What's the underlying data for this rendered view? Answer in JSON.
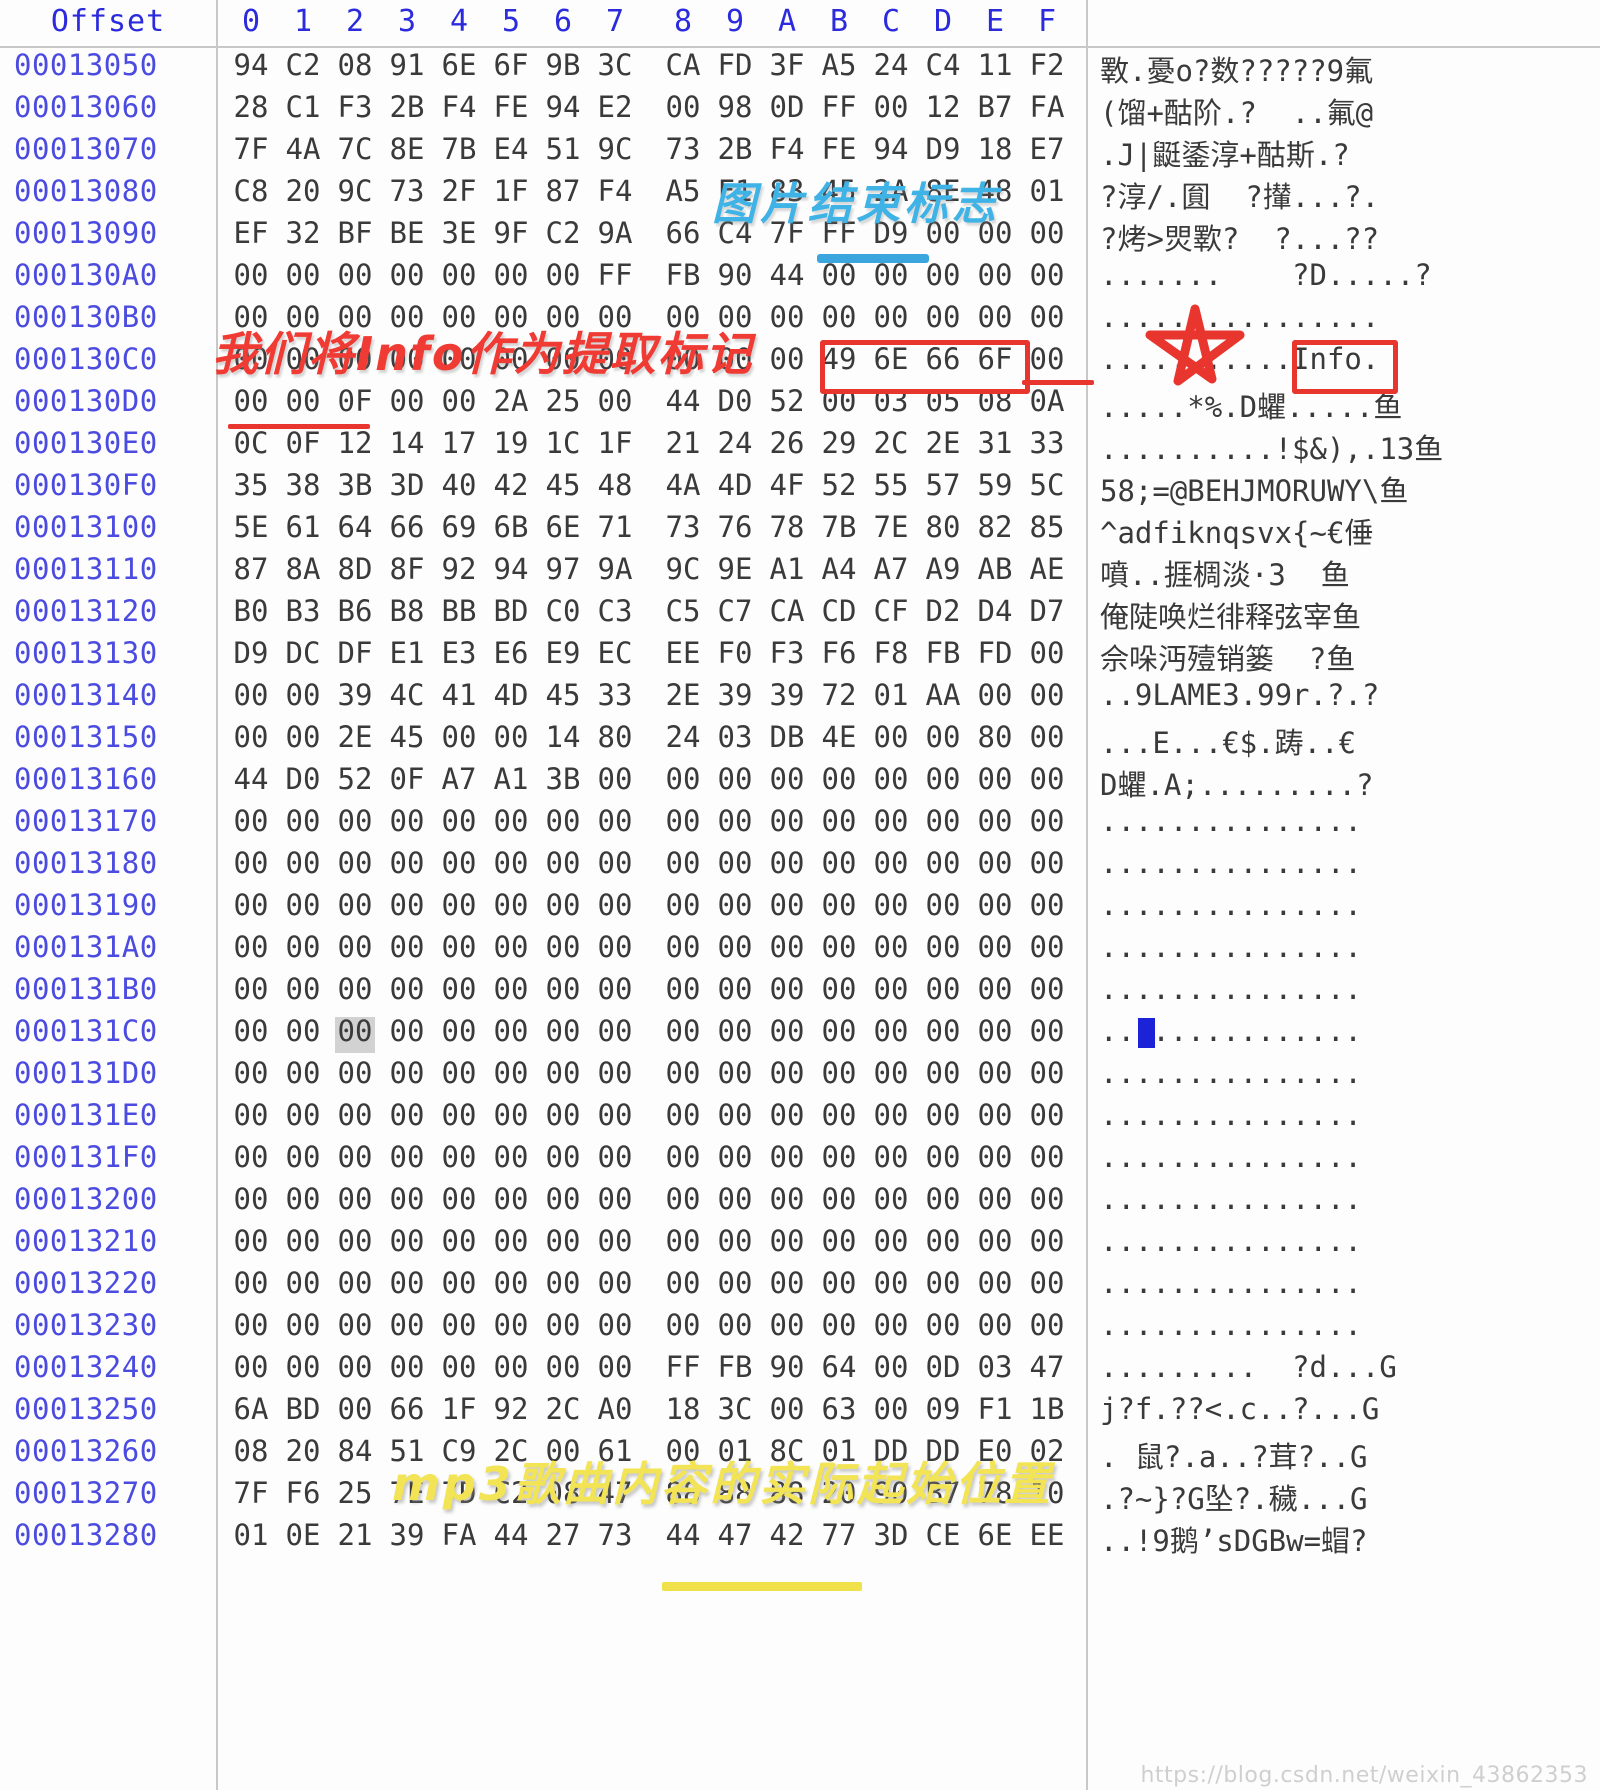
{
  "app": {
    "type": "hex-editor",
    "pane_labels": {
      "offset": "Offset"
    },
    "column_headers": [
      "0",
      "1",
      "2",
      "3",
      "4",
      "5",
      "6",
      "7",
      "8",
      "9",
      "A",
      "B",
      "C",
      "D",
      "E",
      "F"
    ]
  },
  "colors": {
    "offset_text": "#4b4be0",
    "header_text": "#2b2bdd",
    "hex_text": "#3a3a3a",
    "annotation_red": "#ef3b33",
    "annotation_blue": "#3fb3e6",
    "annotation_yellow": "#f2e455",
    "selection_blue": "#1b22d8",
    "selection_grey": "#d2d2d2",
    "grid_line": "#c8c8c8"
  },
  "rows": [
    {
      "offset": "00013050",
      "bytes": [
        "94",
        "C2",
        "08",
        "91",
        "6E",
        "6F",
        "9B",
        "3C",
        "CA",
        "FD",
        "3F",
        "A5",
        "24",
        "C4",
        "11",
        "F2"
      ],
      "ascii": "斁.憂o?数?????9氟"
    },
    {
      "offset": "00013060",
      "bytes": [
        "28",
        "C1",
        "F3",
        "2B",
        "F4",
        "FE",
        "94",
        "E2",
        "00",
        "98",
        "0D",
        "FF",
        "00",
        "12",
        "B7",
        "FA"
      ],
      "ascii": "(馏+酤阶.?  ..氟@"
    },
    {
      "offset": "00013070",
      "bytes": [
        "7F",
        "4A",
        "7C",
        "8E",
        "7B",
        "E4",
        "51",
        "9C",
        "73",
        "2B",
        "F4",
        "FE",
        "94",
        "D9",
        "18",
        "E7"
      ],
      "ascii": ".J|鼮鋈淳+酤斯.?"
    },
    {
      "offset": "00013080",
      "bytes": [
        "C8",
        "20",
        "9C",
        "73",
        "2F",
        "1F",
        "87",
        "F4",
        "A5",
        "F1",
        "83",
        "45",
        "2A",
        "8E",
        "48",
        "01"
      ],
      "ascii": "?淳/.圎  ?攆...?."
    },
    {
      "offset": "00013090",
      "bytes": [
        "EF",
        "32",
        "BF",
        "BE",
        "3E",
        "9F",
        "C2",
        "9A",
        "66",
        "C4",
        "7F",
        "FF",
        "D9",
        "00",
        "00",
        "00"
      ],
      "ascii": "?烤>焸歝?  ?...??"
    },
    {
      "offset": "000130A0",
      "bytes": [
        "00",
        "00",
        "00",
        "00",
        "00",
        "00",
        "00",
        "FF",
        "FB",
        "90",
        "44",
        "00",
        "00",
        "00",
        "00",
        "00"
      ],
      "ascii": ".......    ?D.....?"
    },
    {
      "offset": "000130B0",
      "bytes": [
        "00",
        "00",
        "00",
        "00",
        "00",
        "00",
        "00",
        "00",
        "00",
        "00",
        "00",
        "00",
        "00",
        "00",
        "00",
        "00"
      ],
      "ascii": "................"
    },
    {
      "offset": "000130C0",
      "bytes": [
        "00",
        "00",
        "00",
        "00",
        "00",
        "00",
        "00",
        "00",
        "00",
        "00",
        "00",
        "49",
        "6E",
        "66",
        "6F",
        "00"
      ],
      "ascii": "...........Info."
    },
    {
      "offset": "000130D0",
      "bytes": [
        "00",
        "00",
        "0F",
        "00",
        "00",
        "2A",
        "25",
        "00",
        "44",
        "D0",
        "52",
        "00",
        "03",
        "05",
        "08",
        "0A"
      ],
      "ascii": ".....*%.D蠷.....鱼"
    },
    {
      "offset": "000130E0",
      "bytes": [
        "0C",
        "0F",
        "12",
        "14",
        "17",
        "19",
        "1C",
        "1F",
        "21",
        "24",
        "26",
        "29",
        "2C",
        "2E",
        "31",
        "33"
      ],
      "ascii": "..........!$&),.13鱼"
    },
    {
      "offset": "000130F0",
      "bytes": [
        "35",
        "38",
        "3B",
        "3D",
        "40",
        "42",
        "45",
        "48",
        "4A",
        "4D",
        "4F",
        "52",
        "55",
        "57",
        "59",
        "5C"
      ],
      "ascii": "58;=@BEHJMORUWY\\鱼"
    },
    {
      "offset": "00013100",
      "bytes": [
        "5E",
        "61",
        "64",
        "66",
        "69",
        "6B",
        "6E",
        "71",
        "73",
        "76",
        "78",
        "7B",
        "7E",
        "80",
        "82",
        "85"
      ],
      "ascii": "^adfiknqsvx{~€倕"
    },
    {
      "offset": "00013110",
      "bytes": [
        "87",
        "8A",
        "8D",
        "8F",
        "92",
        "94",
        "97",
        "9A",
        "9C",
        "9E",
        "A1",
        "A4",
        "A7",
        "A9",
        "AB",
        "AE"
      ],
      "ascii": "噴..捱椆淡·3  鱼"
    },
    {
      "offset": "00013120",
      "bytes": [
        "B0",
        "B3",
        "B6",
        "B8",
        "BB",
        "BD",
        "C0",
        "C3",
        "C5",
        "C7",
        "CA",
        "CD",
        "CF",
        "D2",
        "D4",
        "D7"
      ],
      "ascii": "俺陡唤烂徘释弦宰鱼"
    },
    {
      "offset": "00013130",
      "bytes": [
        "D9",
        "DC",
        "DF",
        "E1",
        "E3",
        "E6",
        "E9",
        "EC",
        "EE",
        "F0",
        "F3",
        "F6",
        "F8",
        "FB",
        "FD",
        "00"
      ],
      "ascii": "佘哚沔殪销篓  ?鱼"
    },
    {
      "offset": "00013140",
      "bytes": [
        "00",
        "00",
        "39",
        "4C",
        "41",
        "4D",
        "45",
        "33",
        "2E",
        "39",
        "39",
        "72",
        "01",
        "AA",
        "00",
        "00"
      ],
      "ascii": "..9LAME3.99r.?.?"
    },
    {
      "offset": "00013150",
      "bytes": [
        "00",
        "00",
        "2E",
        "45",
        "00",
        "00",
        "14",
        "80",
        "24",
        "03",
        "DB",
        "4E",
        "00",
        "00",
        "80",
        "00"
      ],
      "ascii": "...E...€$.踌..€"
    },
    {
      "offset": "00013160",
      "bytes": [
        "44",
        "D0",
        "52",
        "0F",
        "A7",
        "A1",
        "3B",
        "00",
        "00",
        "00",
        "00",
        "00",
        "00",
        "00",
        "00",
        "00"
      ],
      "ascii": "D蠷.A;.........?"
    },
    {
      "offset": "00013170",
      "bytes": [
        "00",
        "00",
        "00",
        "00",
        "00",
        "00",
        "00",
        "00",
        "00",
        "00",
        "00",
        "00",
        "00",
        "00",
        "00",
        "00"
      ],
      "ascii": "..............."
    },
    {
      "offset": "00013180",
      "bytes": [
        "00",
        "00",
        "00",
        "00",
        "00",
        "00",
        "00",
        "00",
        "00",
        "00",
        "00",
        "00",
        "00",
        "00",
        "00",
        "00"
      ],
      "ascii": "..............."
    },
    {
      "offset": "00013190",
      "bytes": [
        "00",
        "00",
        "00",
        "00",
        "00",
        "00",
        "00",
        "00",
        "00",
        "00",
        "00",
        "00",
        "00",
        "00",
        "00",
        "00"
      ],
      "ascii": "..............."
    },
    {
      "offset": "000131A0",
      "bytes": [
        "00",
        "00",
        "00",
        "00",
        "00",
        "00",
        "00",
        "00",
        "00",
        "00",
        "00",
        "00",
        "00",
        "00",
        "00",
        "00"
      ],
      "ascii": "..............."
    },
    {
      "offset": "000131B0",
      "bytes": [
        "00",
        "00",
        "00",
        "00",
        "00",
        "00",
        "00",
        "00",
        "00",
        "00",
        "00",
        "00",
        "00",
        "00",
        "00",
        "00"
      ],
      "ascii": "..............."
    },
    {
      "offset": "000131C0",
      "bytes": [
        "00",
        "00",
        "00",
        "00",
        "00",
        "00",
        "00",
        "00",
        "00",
        "00",
        "00",
        "00",
        "00",
        "00",
        "00",
        "00"
      ],
      "ascii": "..............."
    },
    {
      "offset": "000131D0",
      "bytes": [
        "00",
        "00",
        "00",
        "00",
        "00",
        "00",
        "00",
        "00",
        "00",
        "00",
        "00",
        "00",
        "00",
        "00",
        "00",
        "00"
      ],
      "ascii": "..............."
    },
    {
      "offset": "000131E0",
      "bytes": [
        "00",
        "00",
        "00",
        "00",
        "00",
        "00",
        "00",
        "00",
        "00",
        "00",
        "00",
        "00",
        "00",
        "00",
        "00",
        "00"
      ],
      "ascii": "..............."
    },
    {
      "offset": "000131F0",
      "bytes": [
        "00",
        "00",
        "00",
        "00",
        "00",
        "00",
        "00",
        "00",
        "00",
        "00",
        "00",
        "00",
        "00",
        "00",
        "00",
        "00"
      ],
      "ascii": "..............."
    },
    {
      "offset": "00013200",
      "bytes": [
        "00",
        "00",
        "00",
        "00",
        "00",
        "00",
        "00",
        "00",
        "00",
        "00",
        "00",
        "00",
        "00",
        "00",
        "00",
        "00"
      ],
      "ascii": "..............."
    },
    {
      "offset": "00013210",
      "bytes": [
        "00",
        "00",
        "00",
        "00",
        "00",
        "00",
        "00",
        "00",
        "00",
        "00",
        "00",
        "00",
        "00",
        "00",
        "00",
        "00"
      ],
      "ascii": "..............."
    },
    {
      "offset": "00013220",
      "bytes": [
        "00",
        "00",
        "00",
        "00",
        "00",
        "00",
        "00",
        "00",
        "00",
        "00",
        "00",
        "00",
        "00",
        "00",
        "00",
        "00"
      ],
      "ascii": "..............."
    },
    {
      "offset": "00013230",
      "bytes": [
        "00",
        "00",
        "00",
        "00",
        "00",
        "00",
        "00",
        "00",
        "00",
        "00",
        "00",
        "00",
        "00",
        "00",
        "00",
        "00"
      ],
      "ascii": "..............."
    },
    {
      "offset": "00013240",
      "bytes": [
        "00",
        "00",
        "00",
        "00",
        "00",
        "00",
        "00",
        "00",
        "FF",
        "FB",
        "90",
        "64",
        "00",
        "0D",
        "03",
        "47"
      ],
      "ascii": ".........  ?d...G"
    },
    {
      "offset": "00013250",
      "bytes": [
        "6A",
        "BD",
        "00",
        "66",
        "1F",
        "92",
        "2C",
        "A0",
        "18",
        "3C",
        "00",
        "63",
        "00",
        "09",
        "F1",
        "1B"
      ],
      "ascii": "j?f.??<.c..?...G"
    },
    {
      "offset": "00013260",
      "bytes": [
        "08",
        "20",
        "84",
        "51",
        "C9",
        "2C",
        "00",
        "61",
        "00",
        "01",
        "8C",
        "01",
        "DD",
        "DD",
        "E0",
        "02"
      ],
      "ascii": ". 鼠?.a..?茸?..G"
    },
    {
      "offset": "00013270",
      "bytes": [
        "7F",
        "F6",
        "25",
        "7E",
        "7D",
        "C2",
        "08",
        "47",
        "88",
        "88",
        "88",
        "20",
        "90",
        "B7",
        "78",
        "10"
      ],
      "ascii": ".?~}?G坠?.穢...G"
    },
    {
      "offset": "00013280",
      "bytes": [
        "01",
        "0E",
        "21",
        "39",
        "FA",
        "44",
        "27",
        "73",
        "44",
        "47",
        "42",
        "77",
        "3D",
        "CE",
        "6E",
        "EE"
      ],
      "ascii": "..!9鹅’sDGBw=蝐?"
    }
  ],
  "annotations": {
    "blue_note": {
      "text": "图片结束标志",
      "meaning": "image-end-marker",
      "marks_bytes": "FF D9",
      "marks_row": "00013090"
    },
    "red_note": {
      "text": "我们将Info作为提取标记",
      "meaning": "we-use-Info-as-extraction-marker",
      "marks_bytes": "49 6E 66 6F",
      "marks_row": "000130C0",
      "ascii_marked": "Info"
    },
    "yellow_note": {
      "text": "mp3歌曲内容的实际起始位置",
      "meaning": "actual-start-position-of-mp3-song-content",
      "marks_bytes": "FF FB 90 64",
      "marks_row": "00013240"
    },
    "star_mark": "red-hand-drawn-star"
  },
  "watermark": {
    "text": "https://blog.csdn.net/weixin_43862353"
  }
}
